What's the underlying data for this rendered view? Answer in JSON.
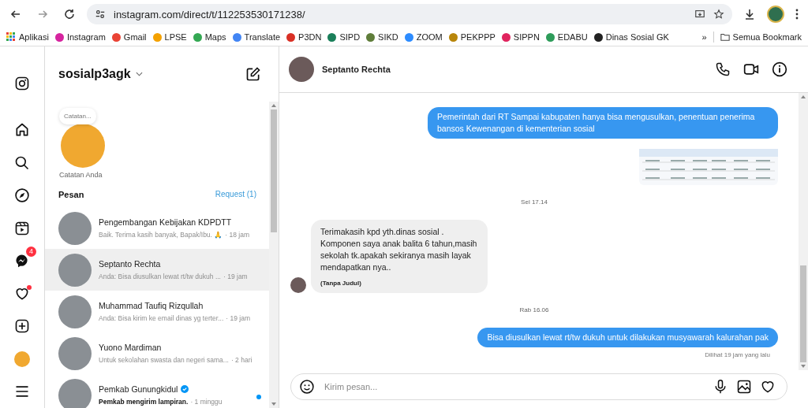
{
  "browser": {
    "url": "instagram.com/direct/t/112253530171238/",
    "apps_label": "Aplikasi",
    "bookmarks": [
      {
        "label": "Instagram",
        "color": "#d6249f"
      },
      {
        "label": "Gmail",
        "color": "#ea4335"
      },
      {
        "label": "LPSE",
        "color": "#f4a100"
      },
      {
        "label": "Maps",
        "color": "#34a853"
      },
      {
        "label": "Translate",
        "color": "#4285f4"
      },
      {
        "label": "P3DN",
        "color": "#d93025"
      },
      {
        "label": "SIPD",
        "color": "#1a7f5a"
      },
      {
        "label": "SIKD",
        "color": "#5f7d3a"
      },
      {
        "label": "ZOOM",
        "color": "#2d8cff"
      },
      {
        "label": "PEKPPP",
        "color": "#b8860b"
      },
      {
        "label": "SIPPN",
        "color": "#e0245e"
      },
      {
        "label": "EDABU",
        "color": "#2e9c5a"
      },
      {
        "label": "Dinas Sosial GK",
        "color": "#222222"
      }
    ],
    "overflow": "»",
    "all_bookmarks": "Semua Bookmark"
  },
  "nav": [
    {
      "kind": "instagram"
    },
    {
      "kind": "home"
    },
    {
      "kind": "search"
    },
    {
      "kind": "explore"
    },
    {
      "kind": "reels"
    },
    {
      "kind": "messages",
      "badge": "4"
    },
    {
      "kind": "notifications",
      "dot": true
    },
    {
      "kind": "create"
    },
    {
      "kind": "profile"
    },
    {
      "kind": "menu"
    }
  ],
  "inbox": {
    "account": "sosialp3agk",
    "note_bubble": "Catatan...",
    "note_label": "Catatan Anda",
    "heading": "Pesan",
    "requests": "Request (1)",
    "conversations": [
      {
        "name": "Pengembangan Kebijakan KDPDTT",
        "preview": "Baik. Terima kasih banyak, Bapak/Ibu. 🙏",
        "time": "· 18 jam",
        "selected": false,
        "unread": false,
        "verified": false
      },
      {
        "name": "Septanto Rechta",
        "preview": "Anda: Bisa diusulkan lewat rt/tw dukuh ...",
        "time": "· 19 jam",
        "selected": true,
        "unread": false,
        "verified": false
      },
      {
        "name": "Muhammad Taufiq Rizqullah",
        "preview": "Anda: Bisa kirim ke email dinas yg terter...",
        "time": "· 19 jam",
        "selected": false,
        "unread": false,
        "verified": false
      },
      {
        "name": "Yuono Mardiman",
        "preview": "Untuk sekolahan swasta dan negeri sama...",
        "time": "· 2 hari",
        "selected": false,
        "unread": false,
        "verified": false
      },
      {
        "name": "Pemkab Gunungkidul",
        "preview": "Pemkab mengirim lampiran.",
        "time": "· 1 minggu",
        "selected": false,
        "unread": true,
        "verified": true
      }
    ]
  },
  "chat": {
    "contact": "Septanto Rechta",
    "messages": [
      {
        "kind": "outgoing",
        "text": "Pemerintah dari RT Sampai kabupaten hanya bisa mengusulkan, penentuan penerima bansos Kewenangan di kementerian sosial"
      },
      {
        "kind": "attachment"
      },
      {
        "kind": "timestamp",
        "text": "Sel 17.14"
      },
      {
        "kind": "incoming",
        "text": "Terimakasih kpd yth.dinas sosial . Komponen saya anak balita 6 tahun,masih sekolah tk.apakah sekiranya masih layak mendapatkan nya..",
        "caption": "(Tanpa Judul)"
      },
      {
        "kind": "timestamp",
        "text": "Rab 16.06"
      },
      {
        "kind": "outgoing",
        "text": "Bisa diusulkan lewat rt/tw dukuh untuk dilakukan musyawarah kalurahan pak"
      }
    ],
    "seen": "Dilihat 19 jam yang lalu",
    "placeholder": "Kirim pesan..."
  }
}
